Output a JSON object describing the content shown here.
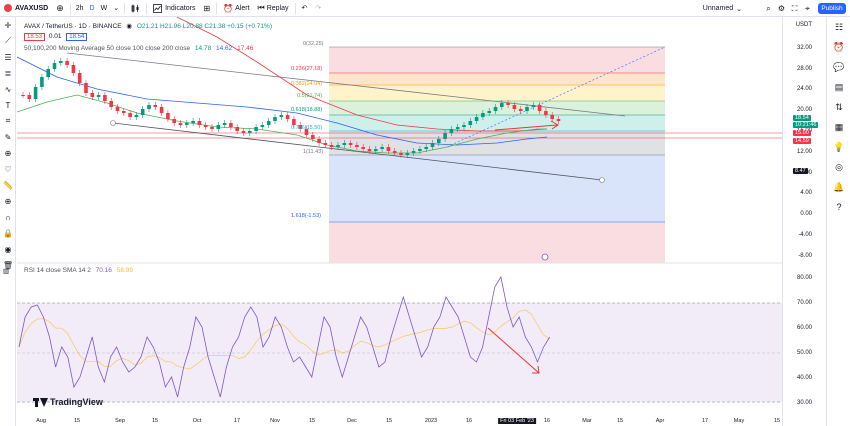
{
  "toolbar": {
    "symbol": "AVAXUSD",
    "interval": "2h",
    "tf_d": "D",
    "tf_w": "W",
    "indicators_label": "Indicators",
    "alert_label": "Alert",
    "replay_label": "Replay",
    "layout_name": "Unnamed",
    "publish_label": "Publish"
  },
  "legend": {
    "title": "AVAX / TetherUS · 1D · BINANCE",
    "ohlc": "O21.21 H21.96 L20.88 C21.38 +0.15 (+0.71%)",
    "price_box_1": "18.53",
    "spread": "0.01",
    "price_box_2": "18.54",
    "ma_label": "50,100,200 Moving Average 50 close 100 close 200 close",
    "ma_1": "14.78",
    "ma_2": "14.62",
    "ma_3": "17.46"
  },
  "rsi_legend": {
    "label": "RSI 14 close SMA 14 2",
    "v1": "70.16",
    "v2": "58.99"
  },
  "fib_labels": [
    {
      "text": "0(32.25)",
      "color": "#787b86"
    },
    {
      "text": "0.236(27.18)",
      "color": "#f23645"
    },
    {
      "text": "0.382(24.04)",
      "color": "#ff9800"
    },
    {
      "text": "0.5(21.74)",
      "color": "#4caf50"
    },
    {
      "text": "0.618(18.88)",
      "color": "#089981"
    },
    {
      "text": "0.786(15.50)",
      "color": "#00bcd4"
    },
    {
      "text": "1(11.43)",
      "color": "#787b86"
    },
    {
      "text": "1.618(-1.53)",
      "color": "#2962ff"
    }
  ],
  "price_axis": {
    "currency": "USDT",
    "labels": [
      "32.00",
      "28.00",
      "24.00",
      "20.00",
      "16.00",
      "12.00",
      "8.00",
      "4.00",
      "0.00",
      "-4.00",
      "-8.00"
    ],
    "tag_current": "18.54",
    "tag_countdown": "10:21:46",
    "tag_ma_a": "15.00",
    "tag_ma_b": "14.59",
    "tag_cursor": "8.47"
  },
  "rsi_axis": {
    "labels": [
      "80.00",
      "70.00",
      "60.00",
      "50.00",
      "40.00",
      "30.00"
    ]
  },
  "time_axis": {
    "labels": [
      "Aug",
      "15",
      "Sep",
      "15",
      "Oct",
      "17",
      "Nov",
      "15",
      "Dec",
      "15",
      "2023",
      "16",
      "Fri 03 Feb '23",
      "16",
      "Mar",
      "15",
      "Apr",
      "17",
      "May",
      "15"
    ]
  },
  "branding": {
    "logo_text": "TradingView"
  },
  "colors": {
    "accent": "#2962ff",
    "up": "#089981",
    "down": "#f23645",
    "rsi_line": "#7e57c2",
    "annotation_arrow": "#e53935"
  }
}
